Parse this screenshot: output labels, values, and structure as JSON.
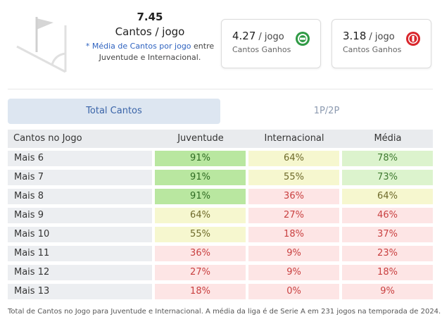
{
  "summary": {
    "value": "7.45",
    "unit": "Cantos / jogo",
    "desc_highlight": "* Média de Cantos por jogo",
    "desc_rest": " entre",
    "desc_line2": "Juventude e Internacional."
  },
  "cards": [
    {
      "value": "4.27",
      "unit": "/ jogo",
      "label": "Cantos Ganhos",
      "team_icon": "juventude-crest-icon"
    },
    {
      "value": "3.18",
      "unit": "/ jogo",
      "label": "Cantos Ganhos",
      "team_icon": "internacional-crest-icon"
    }
  ],
  "tabs": [
    {
      "label": "Total Cantos",
      "active": true
    },
    {
      "label": "1P/2P",
      "active": false
    }
  ],
  "table": {
    "headers": [
      "Cantos no Jogo",
      "Juventude",
      "Internacional",
      "Média"
    ],
    "rows": [
      {
        "label": "Mais 6",
        "values": [
          91,
          64,
          78
        ]
      },
      {
        "label": "Mais 7",
        "values": [
          91,
          55,
          73
        ]
      },
      {
        "label": "Mais 8",
        "values": [
          91,
          36,
          64
        ]
      },
      {
        "label": "Mais 9",
        "values": [
          64,
          27,
          46
        ]
      },
      {
        "label": "Mais 10",
        "values": [
          55,
          18,
          37
        ]
      },
      {
        "label": "Mais 11",
        "values": [
          36,
          9,
          23
        ]
      },
      {
        "label": "Mais 12",
        "values": [
          27,
          9,
          18
        ]
      },
      {
        "label": "Mais 13",
        "values": [
          18,
          0,
          9
        ]
      }
    ]
  },
  "colors": {
    "high_bg": "#b9e7a0",
    "high_fg": "#2e6b22",
    "midhigh_bg": "#dcf3cd",
    "midhigh_fg": "#3f7a30",
    "mid_bg": "#f6f7cf",
    "mid_fg": "#6e6a2a",
    "low_bg": "#fde5e5",
    "low_fg": "#c94040",
    "tab_active_bg": "#dde6f1",
    "tab_active_fg": "#3a64a8"
  },
  "footnote": "Total de Cantos no Jogo para Juventude e Internacional. A média da liga é de Serie A em 231 jogos na temporada de 2024."
}
